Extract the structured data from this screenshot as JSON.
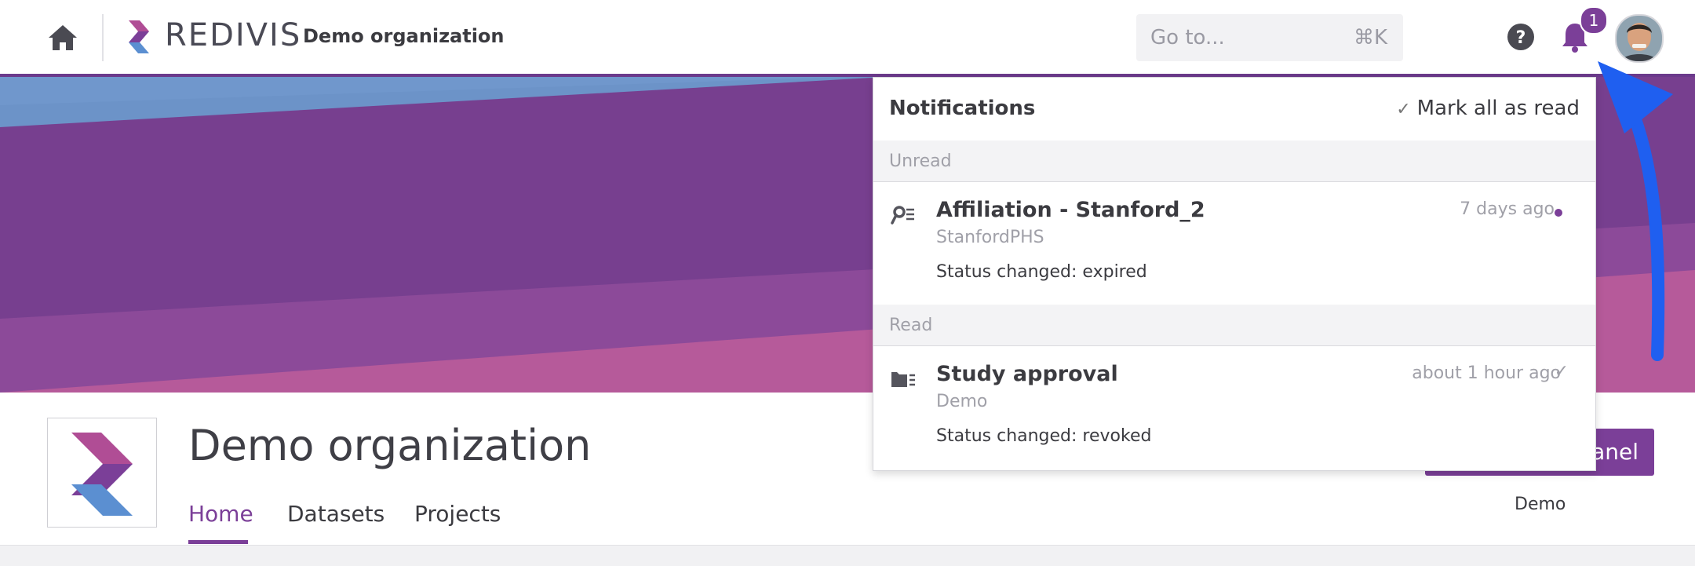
{
  "topbar": {
    "brand_name": "REDIVIS",
    "org_crumb": "Demo organization",
    "search": {
      "placeholder": "Go to...",
      "shortcut": "⌘K"
    },
    "notification_count": "1"
  },
  "notifications": {
    "title": "Notifications",
    "mark_all_label": "Mark all as read",
    "sections": [
      {
        "label": "Unread",
        "items": [
          {
            "icon": "key-icon",
            "title": "Affiliation - Stanford_2",
            "subtitle": "StanfordPHS",
            "body": "Status changed: expired",
            "time": "7 days ago",
            "state": "unread"
          }
        ]
      },
      {
        "label": "Read",
        "items": [
          {
            "icon": "folder-icon",
            "title": "Study approval",
            "subtitle": "Demo",
            "body": "Status changed: revoked",
            "time": "about 1 hour ago",
            "state": "read"
          }
        ]
      }
    ]
  },
  "org": {
    "title": "Demo organization",
    "tabs": [
      {
        "label": "Home",
        "active": true
      },
      {
        "label": "Datasets",
        "active": false
      },
      {
        "label": "Projects",
        "active": false
      }
    ],
    "admin_button_label": "anel",
    "admin_caption": "Demo"
  },
  "colors": {
    "accent": "#7b3f98",
    "banner_purple": "#773f8f",
    "banner_pink": "#b65a9a",
    "banner_blue": "#6c93c8",
    "annotation_arrow": "#1f5ff0"
  }
}
